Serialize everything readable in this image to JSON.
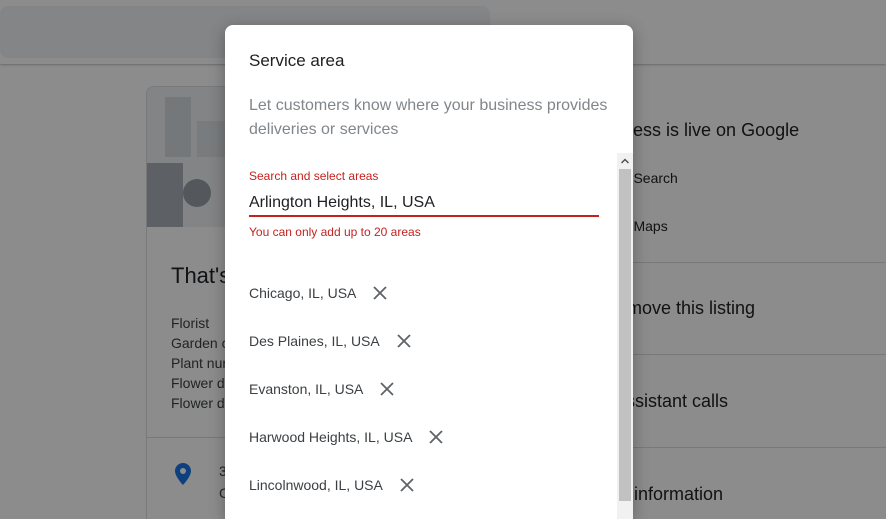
{
  "background": {
    "card": {
      "title": "That's",
      "categories": [
        "Florist",
        "Garden c",
        "Plant nur",
        "Flower de",
        "Flower de"
      ],
      "address_line1": "3",
      "address_line2": "C"
    },
    "right_panel": {
      "heading": "usiness is live on Google",
      "view_search": "w on Search",
      "view_maps": "w on Maps",
      "items": [
        "r remove this listing",
        "e Assistant calls",
        "ced information"
      ]
    }
  },
  "dialog": {
    "title": "Service area",
    "description": "Let customers know where your business provides deliveries or services",
    "search": {
      "label": "Search and select areas",
      "value": "Arlington Heights, IL, USA",
      "error": "You can only add up to 20 areas"
    },
    "areas": [
      {
        "label": "Chicago, IL, USA"
      },
      {
        "label": "Des Plaines, IL, USA"
      },
      {
        "label": "Evanston, IL, USA"
      },
      {
        "label": "Harwood Heights, IL, USA"
      },
      {
        "label": "Lincolnwood, IL, USA"
      }
    ]
  },
  "icons": {
    "remove": "close-icon",
    "pin": "location-pin-icon",
    "scroll_up": "chevron-up-icon"
  },
  "colors": {
    "error": "#c5221f",
    "pin": "#1a73e8",
    "scrim": "rgba(0,0,0,0.45)"
  }
}
